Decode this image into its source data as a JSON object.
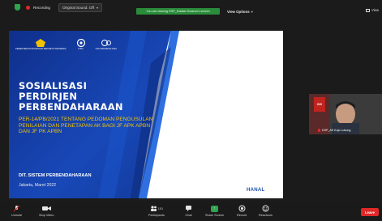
{
  "topbar": {
    "recording_label": "Recording",
    "original_sound": "Original Sound: Off",
    "viewing_notice": "You are viewing DSP_Kadiah Sularso's screen",
    "view_options": "View Options",
    "view_label": "View"
  },
  "slide": {
    "logos": [
      {
        "text": "KEMENTERIAN KEUANGAN\nREPUBLIK INDONESIA"
      },
      {
        "text": "DJPb"
      },
      {
        "text": "G20 INDONESIA\n2022"
      }
    ],
    "title_line1": "SOSIALISASI",
    "title_line2": "PERDIRJEN",
    "title_line3": "PERBENDAHARAAN",
    "subtitle": "PER-14/PB/2021 TENTANG PEDOMAN PENGUSULAN PENILAIAN DAN PENETAPAN AK BAGI JF APK APBN DAN JF PK APBN",
    "department": "DIT. SISTEM PERBENDAHARAAN",
    "date": "Jakarta, Maret 2022",
    "footer_logo": "HANAL"
  },
  "participant": {
    "name": "DSP_AE Kojo Lubung",
    "badge": "G20"
  },
  "toolbar": {
    "unmute": "Unmute",
    "stop_video": "Stop Video",
    "participants": "Participants",
    "participants_count": "101",
    "chat": "Chat",
    "share_screen": "Share Screen",
    "record": "Record",
    "reactions": "Reactions",
    "leave": "Leave"
  },
  "colors": {
    "slide_blue": "#143a9e",
    "title_yellow": "#f2c200",
    "share_green": "#2ea44f",
    "leave_red": "#e02828"
  }
}
